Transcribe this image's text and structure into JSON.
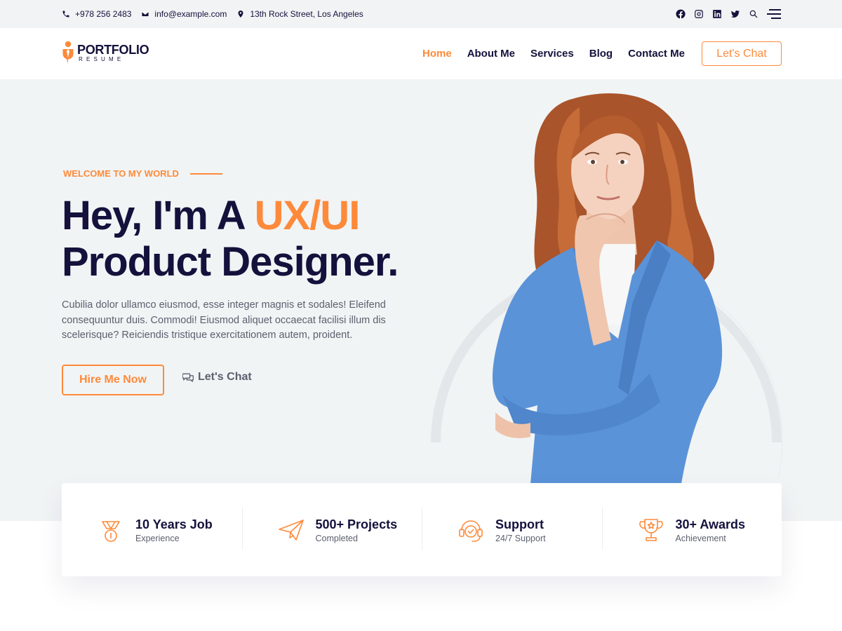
{
  "topbar": {
    "phone": "+978 256 2483",
    "email": "info@example.com",
    "address": "13th Rock Street, Los Angeles",
    "social_icons": [
      "facebook-icon",
      "instagram-icon",
      "linkedin-icon",
      "twitter-icon",
      "search-icon",
      "menu-icon"
    ]
  },
  "header": {
    "logo_title": "PORTFOLIO",
    "logo_subtitle": "RESUME",
    "nav": [
      "Home",
      "About Me",
      "Services",
      "Blog",
      "Contact Me"
    ],
    "active_nav": "Home",
    "cta": "Let's Chat"
  },
  "hero": {
    "kicker": "WELCOME TO MY WORLD",
    "title_part1": "Hey, I'm A ",
    "title_accent": "UX/UI",
    "title_line2": "Product Designer.",
    "description": "Cubilia dolor ullamco eiusmod, esse integer magnis et sodales! Eleifend consequuntur duis. Commodi! Eiusmod aliquet occaecat facilisi illum dis scelerisque? Reiciendis tristique exercitationem autem, proident.",
    "primary_button": "Hire Me Now",
    "secondary_button": "Let's Chat"
  },
  "stats": [
    {
      "icon": "medal-icon",
      "value": "10 Years Job",
      "label": "Experience"
    },
    {
      "icon": "paper-plane-icon",
      "value": "500+ Projects",
      "label": "Completed"
    },
    {
      "icon": "headset-icon",
      "value": "Support",
      "label": "24/7 Support"
    },
    {
      "icon": "trophy-icon",
      "value": "30+ Awards",
      "label": "Achievement"
    }
  ],
  "colors": {
    "accent": "#fd8a3a",
    "dark": "#14113c",
    "muted": "#5c5f6e",
    "hero_bg": "#f1f4f5",
    "blazer": "#5b93d8"
  }
}
